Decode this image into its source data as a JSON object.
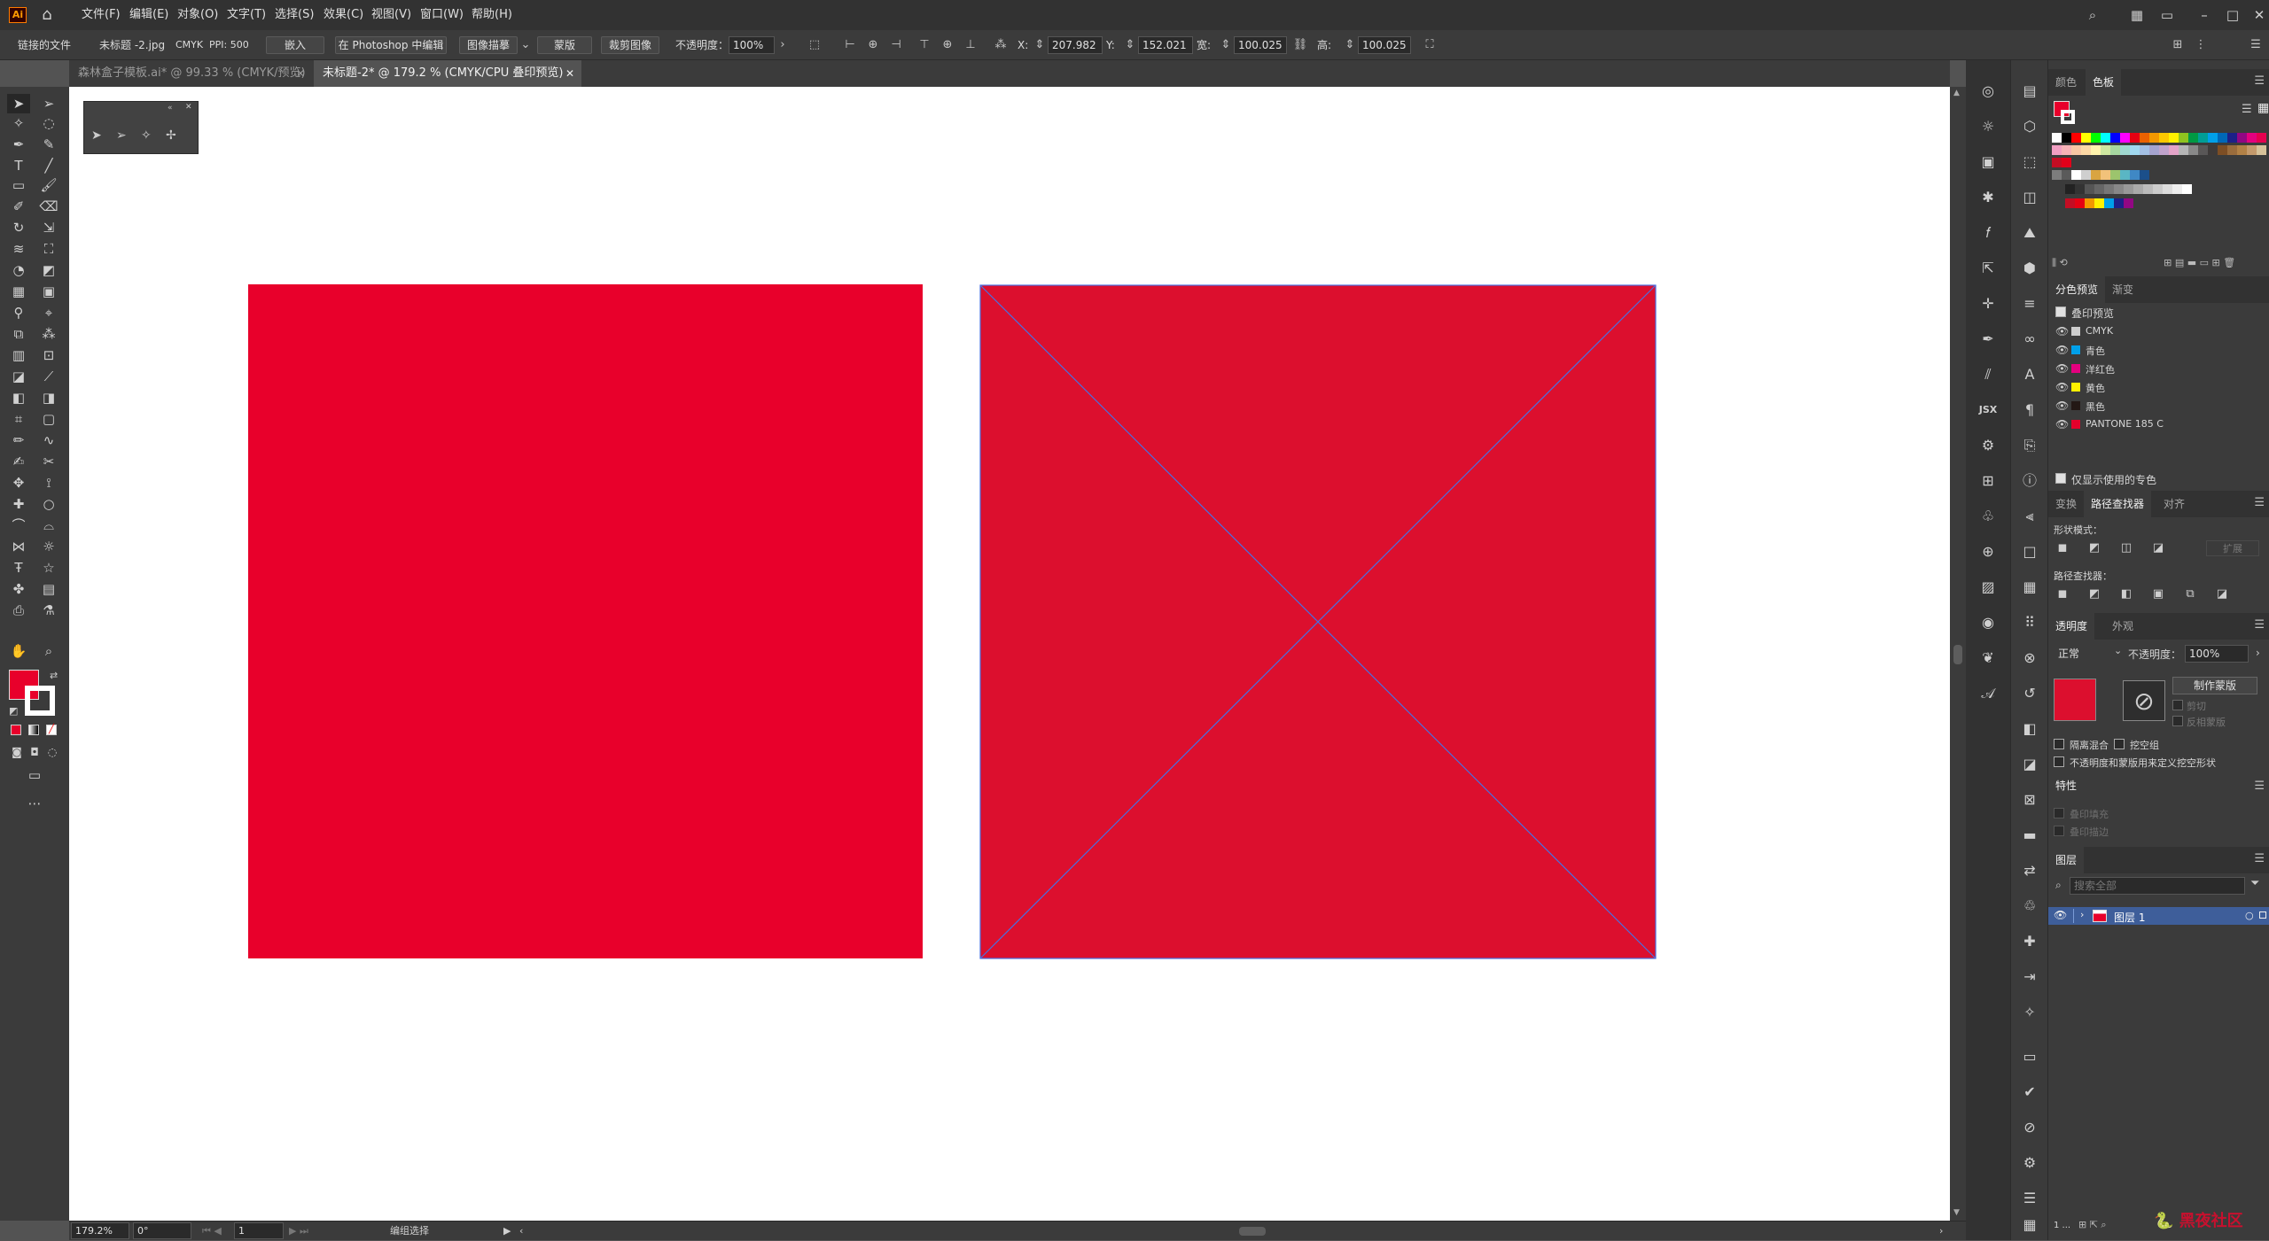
{
  "app": {
    "logo": "Ai",
    "home_icon": "home-icon"
  },
  "menu": {
    "items": [
      "文件(F)",
      "编辑(E)",
      "对象(O)",
      "文字(T)",
      "选择(S)",
      "效果(C)",
      "视图(V)",
      "窗口(W)",
      "帮助(H)"
    ]
  },
  "window_controls": {
    "search": "search-icon",
    "arrange": "arrange-icon",
    "workspace": "workspace-icon",
    "minimize": "minimize-icon",
    "maximize": "maximize-icon",
    "close": "close-icon"
  },
  "control": {
    "linked_file": "链接的文件",
    "filename": "未标题 -2.jpg",
    "colormode": "CMYK",
    "ppi": "PPI: 500",
    "embed": "嵌入",
    "photoshop": "在 Photoshop 中编辑",
    "trace": "图像描摹",
    "mask": "蒙版",
    "crop": "裁剪图像",
    "opacity_label": "不透明度：",
    "opacity_value": "100%",
    "x_label": "X:",
    "x_value": "207.982",
    "y_label": "Y:",
    "y_value": "152.021",
    "w_label": "宽:",
    "w_value": "100.025",
    "h_label": "高:",
    "h_value": "100.025"
  },
  "tabs": [
    {
      "label": "森林盒子模板.ai* @ 99.33 % (CMYK/预览)",
      "active": false
    },
    {
      "label": "未标题-2* @ 179.2 % (CMYK/CPU 叠印预览)",
      "active": true
    }
  ],
  "colors": {
    "fill": "#e8002b",
    "stroke": "#ffffff",
    "rect_left": "#e8002b",
    "rect_right": "#dc0f2e",
    "selection": "#4a6fe0",
    "accent": "#3e5e9a"
  },
  "status": {
    "zoom": "179.2%",
    "rotate": "0°",
    "page": "1",
    "selection_tool": "编组选择"
  },
  "panels": {
    "color_tabs": {
      "color": "颜色",
      "swatches": "色板"
    },
    "separations": {
      "tab1": "分色预览",
      "tab2": "渐变",
      "overprint_label": "叠印预览",
      "inks": [
        "CMYK",
        "青色",
        "洋红色",
        "黄色",
        "黑色",
        "PANTONE 185 C"
      ],
      "ink_colors": [
        "#cccccc",
        "#00a0e9",
        "#e4007f",
        "#fff100",
        "#231815",
        "#e4002b"
      ],
      "spot_only": "仅显示使用的专色"
    },
    "pathfinder": {
      "tab_transform": "变换",
      "tab_pathfinder": "路径查找器",
      "tab_align": "对齐",
      "shape_modes": "形状模式：",
      "expand": "扩展",
      "pathfinders": "路径查找器："
    },
    "transparency": {
      "tab": "透明度",
      "tab2": "外观",
      "blend": "正常",
      "opacity_label": "不透明度：",
      "opacity_value": "100%",
      "make_mask": "制作蒙版",
      "clip": "剪切",
      "invert": "反相蒙版",
      "isolate": "隔离混合",
      "knockout": "挖空组",
      "opacity_mask_shape": "不透明度和蒙版用来定义挖空形状"
    },
    "attributes": {
      "title": "特性",
      "overprint_fill": "叠印填充",
      "overprint_stroke": "叠印描边"
    },
    "layers": {
      "title": "图层",
      "search_placeholder": "搜索全部",
      "layer_name": "图层 1",
      "count": "1 ..."
    }
  },
  "watermark": "黑夜社区"
}
